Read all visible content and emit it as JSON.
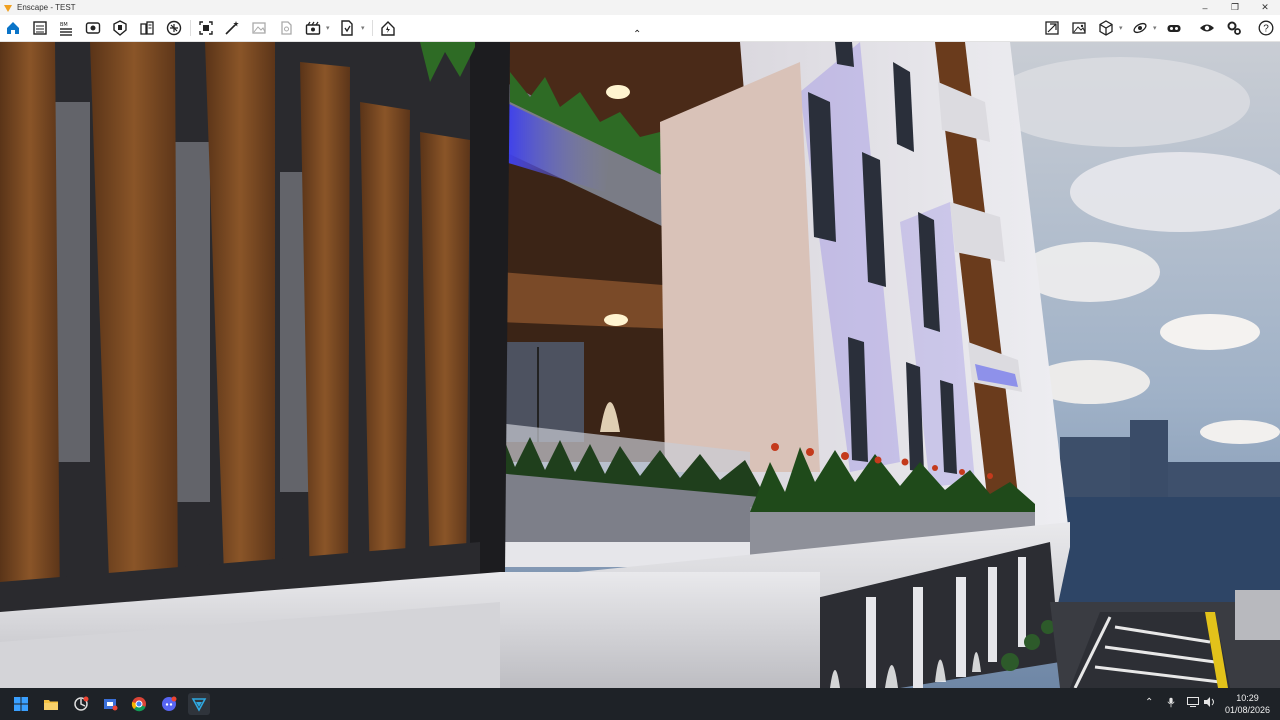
{
  "window": {
    "title": "Enscape - TEST",
    "controls": [
      "minimize-icon",
      "restore-icon",
      "close-icon"
    ]
  },
  "toolbar": {
    "left_icons": [
      "home-icon",
      "views-icon",
      "material-list-icon",
      "visual-settings-icon",
      "asset-library-icon",
      "atlas-icon",
      "upload-icon",
      "screenshot-icon",
      "magic-wand-icon",
      "image-export-icon",
      "panorama-icon",
      "video-export-icon",
      "batch-render-icon",
      "web-standalone-icon"
    ],
    "right_icons": [
      "capture-icon",
      "gallery-icon",
      "cube-icon",
      "orbit-icon",
      "vr-headset-icon",
      "eye-icon",
      "settings-icon",
      "help-icon"
    ],
    "help_label": "?"
  },
  "taskbar": {
    "apps": [
      "windows-start-icon",
      "file-explorer-icon",
      "app-icon",
      "tool-icon",
      "chrome-icon",
      "discord-icon",
      "enscape-icon"
    ],
    "tray_icons": [
      "chevron-up-icon",
      "microphone-icon",
      "network-icon",
      "volume-icon"
    ],
    "time": "10:29",
    "date": "01/08/2026"
  },
  "colors": {
    "toolbar_bg": "#ffffff",
    "accent": "#0a74c8",
    "taskbar_bg": "#1e2227"
  }
}
